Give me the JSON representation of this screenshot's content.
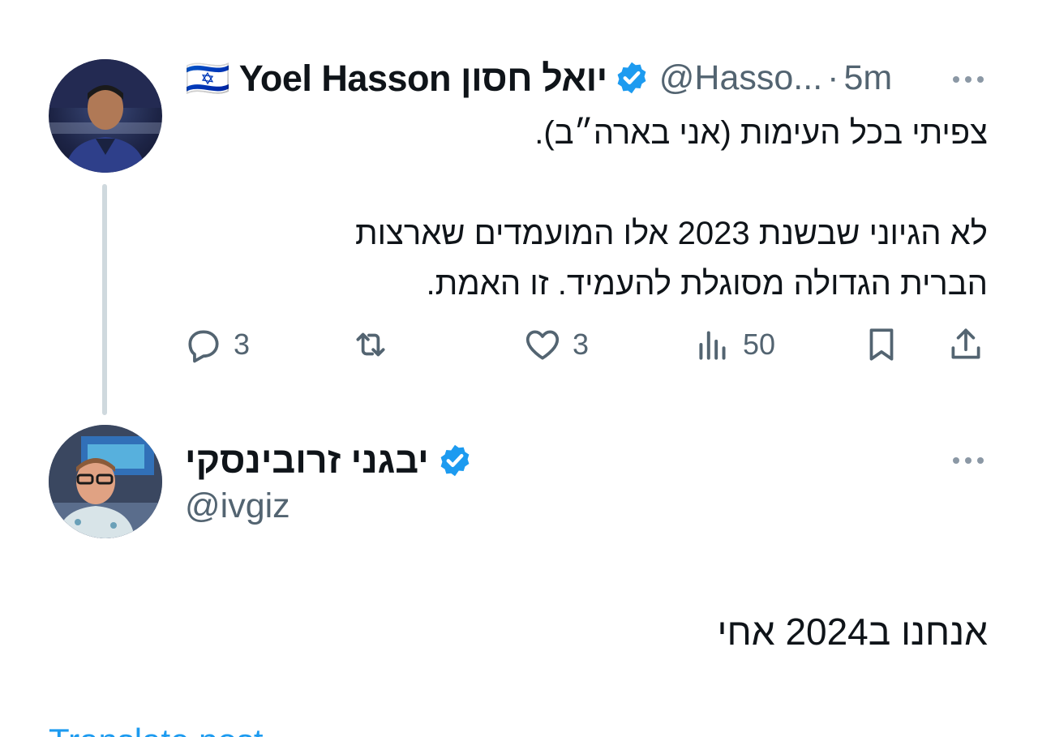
{
  "tweet": {
    "author_name": "🇮🇱 Yoel Hasson יואל חסון",
    "author_handle": "@Hasso...",
    "separator": "·",
    "time": "5m",
    "text_line1": "צפיתי בכל העימות (אני בארה״ב).",
    "text_line2": "לא הגיוני שבשנת 2023 אלו המועמדים  שארצות",
    "text_line3": "הברית הגדולה מסוגלת להעמיד. זו האמת.",
    "stats": {
      "replies": "3",
      "retweets": "",
      "likes": "3",
      "views": "50"
    }
  },
  "reply": {
    "author_name": "יבגני זרובינסקי",
    "author_handle": "@ivgiz",
    "text": "אנחנו ב2024 אחי",
    "translate_label": "Translate post"
  },
  "icons": {
    "reply": "speech-bubble-icon",
    "retweet": "retweet-icon",
    "like": "heart-icon",
    "views": "bar-chart-icon",
    "bookmark": "bookmark-icon",
    "share": "share-icon",
    "verified": "verified-badge-icon",
    "more": "more-options-icon"
  },
  "colors": {
    "text": "#0f1419",
    "secondary": "#536471",
    "accent": "#1d9bf0",
    "thread_line": "#cfd9de",
    "translate": "#1d9bf0"
  }
}
